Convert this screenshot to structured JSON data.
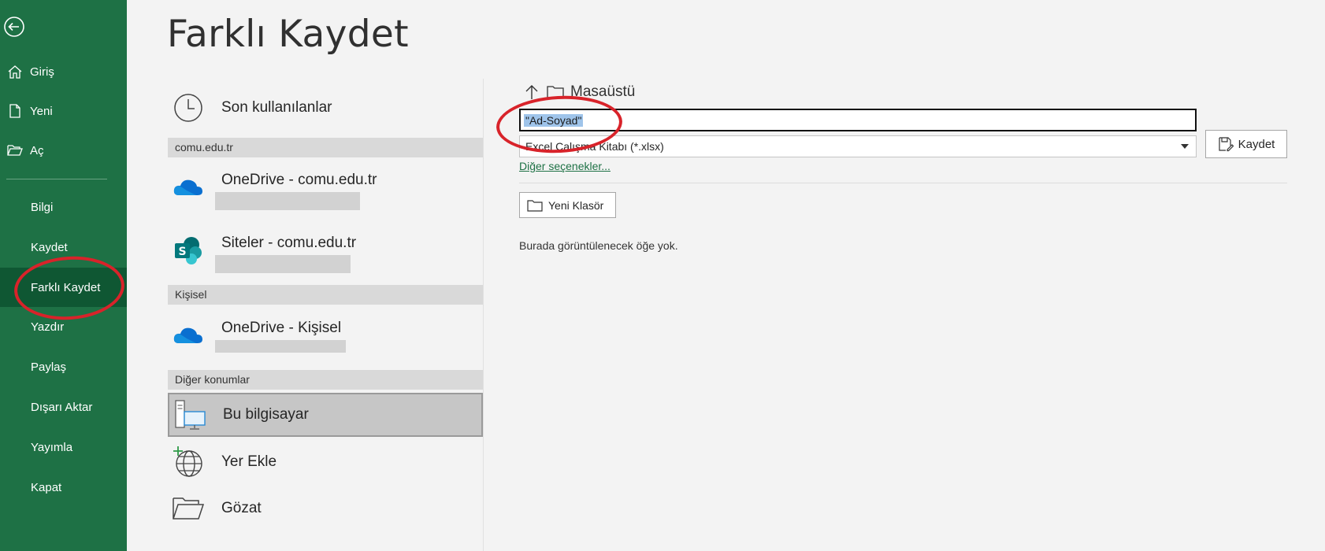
{
  "sidebar": {
    "items": [
      {
        "label": "Giriş",
        "icon": "home-icon"
      },
      {
        "label": "Yeni",
        "icon": "new-document-icon"
      },
      {
        "label": "Aç",
        "icon": "open-folder-icon"
      },
      {
        "label": "Bilgi"
      },
      {
        "label": "Kaydet"
      },
      {
        "label": "Farklı Kaydet",
        "active": true
      },
      {
        "label": "Yazdır"
      },
      {
        "label": "Paylaş"
      },
      {
        "label": "Dışarı Aktar"
      },
      {
        "label": "Yayımla"
      },
      {
        "label": "Kapat"
      }
    ]
  },
  "page": {
    "title": "Farklı Kaydet"
  },
  "locations": {
    "recent": "Son kullanılanlar",
    "section_org": "comu.edu.tr",
    "onedrive_org": "OneDrive - comu.edu.tr",
    "sites_org": "Siteler - comu.edu.tr",
    "section_personal": "Kişisel",
    "onedrive_personal": "OneDrive - Kişisel",
    "section_other": "Diğer konumlar",
    "this_pc": "Bu bilgisayar",
    "add_place": "Yer Ekle",
    "browse": "Gözat"
  },
  "save_pane": {
    "breadcrumb": "Masaüstü",
    "file_name": "\"Ad-Soyad\"",
    "file_type": "Excel Çalışma Kitabı (*.xlsx)",
    "save_label": "Kaydet",
    "more_options": "Diğer seçenekler...",
    "new_folder": "Yeni Klasör",
    "empty_message": "Burada görüntülenecek öğe yok."
  },
  "colors": {
    "sidebar": "#1e7145",
    "sidebar_active": "#0f5733",
    "annotation": "#d8232a"
  }
}
